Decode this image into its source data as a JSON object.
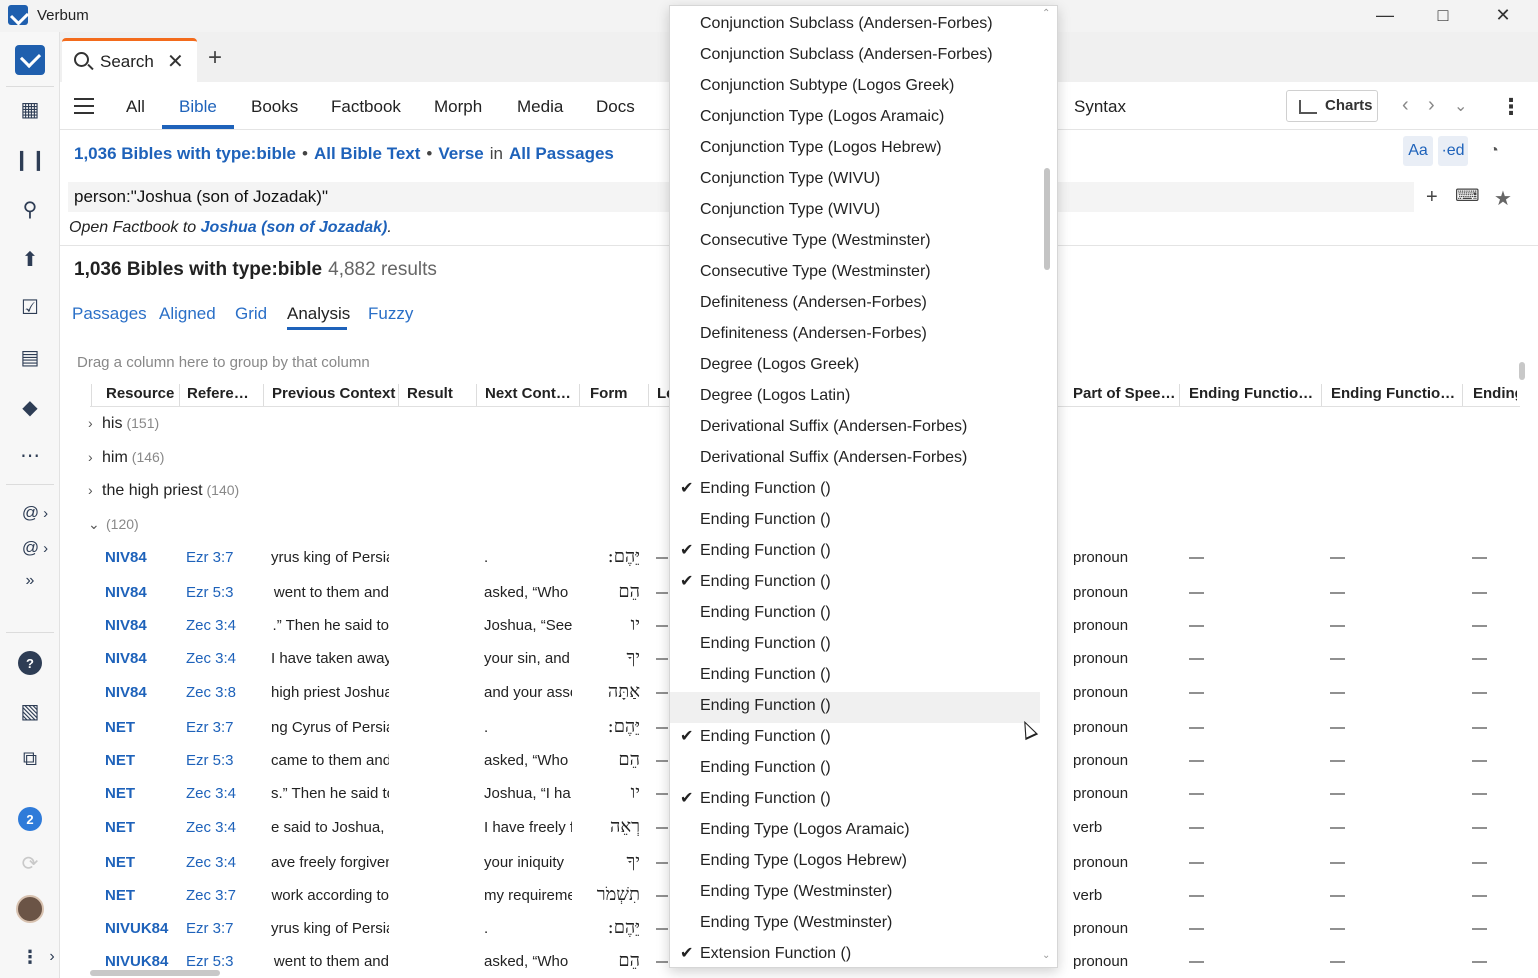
{
  "window": {
    "title": "Verbum"
  },
  "rail": {
    "icons": [
      "logo-icon",
      "dashboard-icon",
      "library-icon",
      "search-icon",
      "upload-icon",
      "tasks-icon",
      "document-icon",
      "shield-icon",
      "apps-icon",
      "at-icon",
      "at-icon",
      "more-icon",
      "help-icon",
      "layouts-icon",
      "close-panels-icon",
      "sync-icon",
      "avatar",
      "kebab-icon",
      "expand-icon"
    ],
    "notifications": "2",
    "at_chevron": "›",
    "expand": "»"
  },
  "tabbar": {
    "tab_label": "Search",
    "close": "✕",
    "add": "+"
  },
  "kinds": [
    "All",
    "Bible",
    "Books",
    "Factbook",
    "Morph",
    "Media",
    "Docs",
    "Syntax"
  ],
  "toolbar": {
    "charts": "Charts",
    "back": "‹",
    "forward": "›",
    "down": "⌄",
    "more": "⋮"
  },
  "scope": {
    "bibles": "1,036 Bibles with type:bible",
    "bullet": "•",
    "text": "All Bible Text",
    "unit": "Verse",
    "in": "in",
    "passages": "All Passages"
  },
  "format": {
    "aa": "Aa",
    "ed": "·ed",
    "hl": "◔"
  },
  "query": {
    "value": "person:\"Joshua (son of Jozadak)\"",
    "add": "+",
    "keyboard": "⌨",
    "star": "★"
  },
  "suggestion": {
    "prefix": "Open Factbook to",
    "link": "Joshua (son of Jozadak)",
    "suffix": "."
  },
  "summary": {
    "title": "1,036 Bibles with type:bible",
    "count": "4,882 results"
  },
  "views": [
    "Passages",
    "Aligned",
    "Grid",
    "Analysis",
    "Fuzzy"
  ],
  "grid": {
    "hint": "Drag a column here to group by that column",
    "columns": [
      "Resource",
      "Refere…",
      "Previous Context",
      "Result",
      "Next Cont…",
      "Form",
      "Le",
      "Part of Spee…",
      "Ending Functio…",
      "Ending Functio…",
      "Ending"
    ],
    "groups": [
      {
        "label": "his",
        "count": "(151)",
        "chev": "›"
      },
      {
        "label": "him",
        "count": "(146)",
        "chev": "›"
      },
      {
        "label": "the  high priest",
        "count": "(140)",
        "chev": "›"
      },
      {
        "label": "",
        "count": "(120)",
        "chev": "⌄"
      }
    ],
    "rows": [
      {
        "resource": "NIV84",
        "ref": "Ezr 3:7",
        "prev": "yrus king of Persia",
        "next": ".",
        "form": ":יֵּהֶם",
        "dash": "—",
        "pos": "pronoun",
        "e1": "—",
        "e2": "—",
        "e3": "—"
      },
      {
        "resource": "NIV84",
        "ref": "Ezr 5:3",
        "prev": "went to them and",
        "next": "asked, “Who",
        "form": "הֵם",
        "dash": "—",
        "pos": "pronoun",
        "e1": "—",
        "e2": "—",
        "e3": "—"
      },
      {
        "resource": "NIV84",
        "ref": "Zec 3:4",
        "prev": ".”  Then he said to",
        "next": "Joshua, “See",
        "form": "יו",
        "dash": "—",
        "pos": "pronoun",
        "e1": "—",
        "e2": "—",
        "e3": "—"
      },
      {
        "resource": "NIV84",
        "ref": "Zec 3:4",
        "prev": "I have taken away",
        "next": "your sin, and",
        "form": "יךָ",
        "dash": "—",
        "pos": "pronoun",
        "e1": "—",
        "e2": "—",
        "e3": "—"
      },
      {
        "resource": "NIV84",
        "ref": "Zec 3:8",
        "prev": "high priest Joshua",
        "next": "and your asso",
        "form": "אַתָּה",
        "dash": "—",
        "pos": "pronoun",
        "e1": "—",
        "e2": "—",
        "e3": "—"
      },
      {
        "resource": "NET",
        "ref": "Ezr 3:7",
        "prev": "ng Cyrus of Persia",
        "next": ".",
        "form": ":יֵּהֶם",
        "dash": "—",
        "pos": "pronoun",
        "e1": "—",
        "e2": "—",
        "e3": "—"
      },
      {
        "resource": "NET",
        "ref": "Ezr 5:3",
        "prev": "came to them and",
        "next": "asked, “Who",
        "form": "הֵם",
        "dash": "—",
        "pos": "pronoun",
        "e1": "—",
        "e2": "—",
        "e3": "—"
      },
      {
        "resource": "NET",
        "ref": "Zec 3:4",
        "prev": "s.” Then he said to",
        "next": "Joshua, “I ha",
        "form": "יו",
        "dash": "—",
        "pos": "pronoun",
        "e1": "—",
        "e2": "—",
        "e3": "—"
      },
      {
        "resource": "NET",
        "ref": "Zec 3:4",
        "prev": "e said to Joshua, “",
        "next": "I have freely f",
        "form": "רְאֵה",
        "dash": "—",
        "pos": "verb",
        "e1": "—",
        "e2": "—",
        "e3": "—"
      },
      {
        "resource": "NET",
        "ref": "Zec 3:4",
        "prev": "ave freely forgiven",
        "next": "your iniquity",
        "form": "יךָ",
        "dash": "—",
        "pos": "pronoun",
        "e1": "—",
        "e2": "—",
        "e3": "—"
      },
      {
        "resource": "NET",
        "ref": "Zec 3:7",
        "prev": "work according to",
        "next": "my requireme",
        "form": "תִשְׁמֹר",
        "dash": "—",
        "pos": "verb",
        "e1": "—",
        "e2": "—",
        "e3": "—"
      },
      {
        "resource": "NIVUK84",
        "ref": "Ezr 3:7",
        "prev": "yrus king of Persia",
        "next": ".",
        "form": ":יֵּהֶם",
        "dash": "—",
        "pos": "pronoun",
        "e1": "—",
        "e2": "—",
        "e3": "—"
      },
      {
        "resource": "NIVUK84",
        "ref": "Ezr 5:3",
        "prev": "went to them and",
        "next": "asked, “Who",
        "form": "הֵם",
        "dash": "—",
        "pos": "pronoun",
        "e1": "—",
        "e2": "—",
        "e3": "—"
      }
    ]
  },
  "menu": {
    "check_glyph": "✔",
    "up": "⌃",
    "down": "⌄",
    "items": [
      {
        "label": "Conjunction Subclass (Andersen-Forbes)",
        "checked": false
      },
      {
        "label": "Conjunction Subclass (Andersen-Forbes)",
        "checked": false
      },
      {
        "label": "Conjunction Subtype (Logos Greek)",
        "checked": false
      },
      {
        "label": "Conjunction Type (Logos Aramaic)",
        "checked": false
      },
      {
        "label": "Conjunction Type (Logos Hebrew)",
        "checked": false
      },
      {
        "label": "Conjunction Type (WIVU)",
        "checked": false
      },
      {
        "label": "Conjunction Type (WIVU)",
        "checked": false
      },
      {
        "label": "Consecutive Type (Westminster)",
        "checked": false
      },
      {
        "label": "Consecutive Type (Westminster)",
        "checked": false
      },
      {
        "label": "Definiteness (Andersen-Forbes)",
        "checked": false
      },
      {
        "label": "Definiteness (Andersen-Forbes)",
        "checked": false
      },
      {
        "label": "Degree (Logos Greek)",
        "checked": false
      },
      {
        "label": "Degree (Logos Latin)",
        "checked": false
      },
      {
        "label": "Derivational Suffix (Andersen-Forbes)",
        "checked": false
      },
      {
        "label": "Derivational Suffix (Andersen-Forbes)",
        "checked": false
      },
      {
        "label": "Ending Function ()",
        "checked": true
      },
      {
        "label": "Ending Function ()",
        "checked": false
      },
      {
        "label": "Ending Function ()",
        "checked": true
      },
      {
        "label": "Ending Function ()",
        "checked": true
      },
      {
        "label": "Ending Function ()",
        "checked": false
      },
      {
        "label": "Ending Function ()",
        "checked": false
      },
      {
        "label": "Ending Function ()",
        "checked": false
      },
      {
        "label": "Ending Function ()",
        "checked": false,
        "hover": true
      },
      {
        "label": "Ending Function ()",
        "checked": true
      },
      {
        "label": "Ending Function ()",
        "checked": false
      },
      {
        "label": "Ending Function ()",
        "checked": true
      },
      {
        "label": "Ending Type (Logos Aramaic)",
        "checked": false
      },
      {
        "label": "Ending Type (Logos Hebrew)",
        "checked": false
      },
      {
        "label": "Ending Type (Westminster)",
        "checked": false
      },
      {
        "label": "Ending Type (Westminster)",
        "checked": false
      },
      {
        "label": "Extension Function ()",
        "checked": true
      }
    ]
  },
  "colors": {
    "accent": "#1e62ba",
    "tab_accent": "#f36b1c",
    "brand": "#1f5fae"
  }
}
